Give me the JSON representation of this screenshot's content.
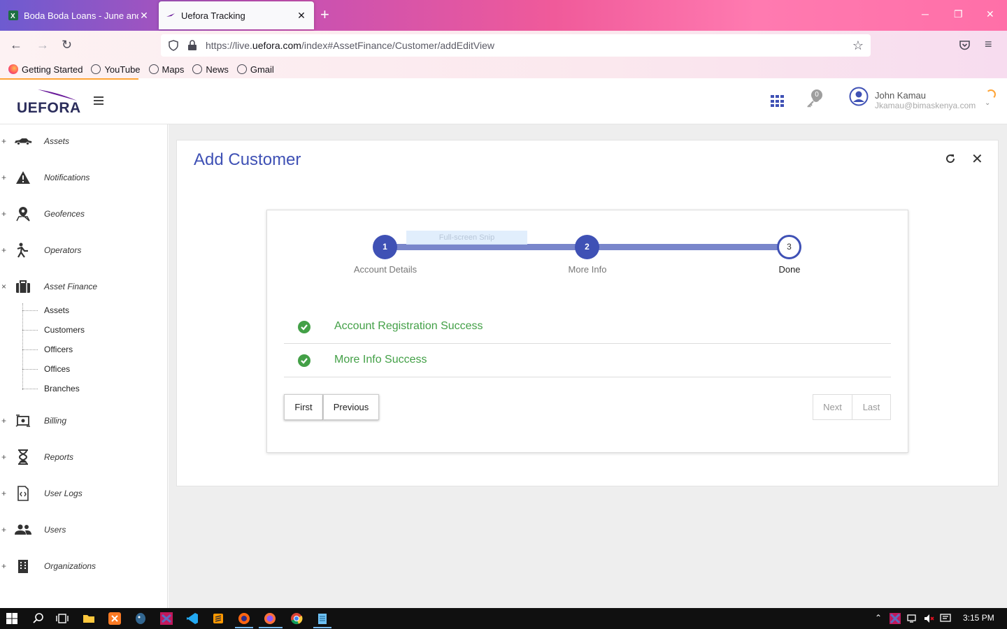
{
  "browser": {
    "tabs": [
      {
        "title": "Boda Boda Loans - June and Jul",
        "active": false
      },
      {
        "title": "Uefora Tracking",
        "active": true
      }
    ],
    "url_prefix": "https://live.",
    "url_domain": "uefora.com",
    "url_path": "/index#AssetFinance/Customer/addEditView",
    "bookmarks": [
      "Getting Started",
      "YouTube",
      "Maps",
      "News",
      "Gmail"
    ]
  },
  "header": {
    "logo_text": "UEFORA",
    "notification_count": "0",
    "user_name": "John Kamau",
    "user_email": "Jkamau@bimaskenya.com"
  },
  "sidebar": {
    "items": [
      {
        "label": "Assets",
        "toggle": "+",
        "icon": "car-icon"
      },
      {
        "label": "Notifications",
        "toggle": "+",
        "icon": "warning-icon"
      },
      {
        "label": "Geofences",
        "toggle": "+",
        "icon": "map-pin-icon"
      },
      {
        "label": "Operators",
        "toggle": "+",
        "icon": "operator-icon"
      },
      {
        "label": "Asset Finance",
        "toggle": "×",
        "icon": "briefcase-icon"
      },
      {
        "label": "Billing",
        "toggle": "+",
        "icon": "billing-icon"
      },
      {
        "label": "Reports",
        "toggle": "+",
        "icon": "hourglass-icon"
      },
      {
        "label": "User Logs",
        "toggle": "+",
        "icon": "file-code-icon"
      },
      {
        "label": "Users",
        "toggle": "+",
        "icon": "people-icon"
      },
      {
        "label": "Organizations",
        "toggle": "+",
        "icon": "building-icon"
      }
    ],
    "asset_finance_sub": [
      "Assets",
      "Customers",
      "Officers",
      "Offices",
      "Branches"
    ]
  },
  "card": {
    "title": "Add Customer"
  },
  "wizard": {
    "steps": [
      {
        "number": "1",
        "label": "Account Details",
        "state": "complete"
      },
      {
        "number": "2",
        "label": "More Info",
        "state": "complete"
      },
      {
        "number": "3",
        "label": "Done",
        "state": "current"
      }
    ],
    "snip_overlay": "Full-screen Snip",
    "results": [
      "Account Registration Success",
      "More Info Success"
    ],
    "buttons": {
      "first": "First",
      "previous": "Previous",
      "next": "Next",
      "last": "Last"
    }
  },
  "taskbar": {
    "time": "3:15 PM"
  },
  "colors": {
    "primary": "#3f51b5",
    "track": "#7986cb",
    "success": "#43a047",
    "accent_loading": "#ffa436"
  }
}
